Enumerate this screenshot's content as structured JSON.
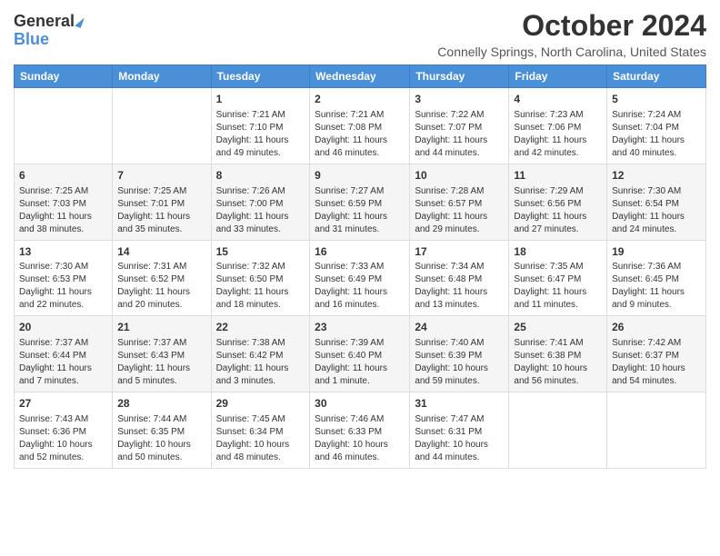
{
  "logo": {
    "general": "General",
    "blue": "Blue"
  },
  "title": "October 2024",
  "subtitle": "Connelly Springs, North Carolina, United States",
  "days_header": [
    "Sunday",
    "Monday",
    "Tuesday",
    "Wednesday",
    "Thursday",
    "Friday",
    "Saturday"
  ],
  "weeks": [
    [
      {
        "day": "",
        "sunrise": "",
        "sunset": "",
        "daylight": ""
      },
      {
        "day": "",
        "sunrise": "",
        "sunset": "",
        "daylight": ""
      },
      {
        "day": "1",
        "sunrise": "Sunrise: 7:21 AM",
        "sunset": "Sunset: 7:10 PM",
        "daylight": "Daylight: 11 hours and 49 minutes."
      },
      {
        "day": "2",
        "sunrise": "Sunrise: 7:21 AM",
        "sunset": "Sunset: 7:08 PM",
        "daylight": "Daylight: 11 hours and 46 minutes."
      },
      {
        "day": "3",
        "sunrise": "Sunrise: 7:22 AM",
        "sunset": "Sunset: 7:07 PM",
        "daylight": "Daylight: 11 hours and 44 minutes."
      },
      {
        "day": "4",
        "sunrise": "Sunrise: 7:23 AM",
        "sunset": "Sunset: 7:06 PM",
        "daylight": "Daylight: 11 hours and 42 minutes."
      },
      {
        "day": "5",
        "sunrise": "Sunrise: 7:24 AM",
        "sunset": "Sunset: 7:04 PM",
        "daylight": "Daylight: 11 hours and 40 minutes."
      }
    ],
    [
      {
        "day": "6",
        "sunrise": "Sunrise: 7:25 AM",
        "sunset": "Sunset: 7:03 PM",
        "daylight": "Daylight: 11 hours and 38 minutes."
      },
      {
        "day": "7",
        "sunrise": "Sunrise: 7:25 AM",
        "sunset": "Sunset: 7:01 PM",
        "daylight": "Daylight: 11 hours and 35 minutes."
      },
      {
        "day": "8",
        "sunrise": "Sunrise: 7:26 AM",
        "sunset": "Sunset: 7:00 PM",
        "daylight": "Daylight: 11 hours and 33 minutes."
      },
      {
        "day": "9",
        "sunrise": "Sunrise: 7:27 AM",
        "sunset": "Sunset: 6:59 PM",
        "daylight": "Daylight: 11 hours and 31 minutes."
      },
      {
        "day": "10",
        "sunrise": "Sunrise: 7:28 AM",
        "sunset": "Sunset: 6:57 PM",
        "daylight": "Daylight: 11 hours and 29 minutes."
      },
      {
        "day": "11",
        "sunrise": "Sunrise: 7:29 AM",
        "sunset": "Sunset: 6:56 PM",
        "daylight": "Daylight: 11 hours and 27 minutes."
      },
      {
        "day": "12",
        "sunrise": "Sunrise: 7:30 AM",
        "sunset": "Sunset: 6:54 PM",
        "daylight": "Daylight: 11 hours and 24 minutes."
      }
    ],
    [
      {
        "day": "13",
        "sunrise": "Sunrise: 7:30 AM",
        "sunset": "Sunset: 6:53 PM",
        "daylight": "Daylight: 11 hours and 22 minutes."
      },
      {
        "day": "14",
        "sunrise": "Sunrise: 7:31 AM",
        "sunset": "Sunset: 6:52 PM",
        "daylight": "Daylight: 11 hours and 20 minutes."
      },
      {
        "day": "15",
        "sunrise": "Sunrise: 7:32 AM",
        "sunset": "Sunset: 6:50 PM",
        "daylight": "Daylight: 11 hours and 18 minutes."
      },
      {
        "day": "16",
        "sunrise": "Sunrise: 7:33 AM",
        "sunset": "Sunset: 6:49 PM",
        "daylight": "Daylight: 11 hours and 16 minutes."
      },
      {
        "day": "17",
        "sunrise": "Sunrise: 7:34 AM",
        "sunset": "Sunset: 6:48 PM",
        "daylight": "Daylight: 11 hours and 13 minutes."
      },
      {
        "day": "18",
        "sunrise": "Sunrise: 7:35 AM",
        "sunset": "Sunset: 6:47 PM",
        "daylight": "Daylight: 11 hours and 11 minutes."
      },
      {
        "day": "19",
        "sunrise": "Sunrise: 7:36 AM",
        "sunset": "Sunset: 6:45 PM",
        "daylight": "Daylight: 11 hours and 9 minutes."
      }
    ],
    [
      {
        "day": "20",
        "sunrise": "Sunrise: 7:37 AM",
        "sunset": "Sunset: 6:44 PM",
        "daylight": "Daylight: 11 hours and 7 minutes."
      },
      {
        "day": "21",
        "sunrise": "Sunrise: 7:37 AM",
        "sunset": "Sunset: 6:43 PM",
        "daylight": "Daylight: 11 hours and 5 minutes."
      },
      {
        "day": "22",
        "sunrise": "Sunrise: 7:38 AM",
        "sunset": "Sunset: 6:42 PM",
        "daylight": "Daylight: 11 hours and 3 minutes."
      },
      {
        "day": "23",
        "sunrise": "Sunrise: 7:39 AM",
        "sunset": "Sunset: 6:40 PM",
        "daylight": "Daylight: 11 hours and 1 minute."
      },
      {
        "day": "24",
        "sunrise": "Sunrise: 7:40 AM",
        "sunset": "Sunset: 6:39 PM",
        "daylight": "Daylight: 10 hours and 59 minutes."
      },
      {
        "day": "25",
        "sunrise": "Sunrise: 7:41 AM",
        "sunset": "Sunset: 6:38 PM",
        "daylight": "Daylight: 10 hours and 56 minutes."
      },
      {
        "day": "26",
        "sunrise": "Sunrise: 7:42 AM",
        "sunset": "Sunset: 6:37 PM",
        "daylight": "Daylight: 10 hours and 54 minutes."
      }
    ],
    [
      {
        "day": "27",
        "sunrise": "Sunrise: 7:43 AM",
        "sunset": "Sunset: 6:36 PM",
        "daylight": "Daylight: 10 hours and 52 minutes."
      },
      {
        "day": "28",
        "sunrise": "Sunrise: 7:44 AM",
        "sunset": "Sunset: 6:35 PM",
        "daylight": "Daylight: 10 hours and 50 minutes."
      },
      {
        "day": "29",
        "sunrise": "Sunrise: 7:45 AM",
        "sunset": "Sunset: 6:34 PM",
        "daylight": "Daylight: 10 hours and 48 minutes."
      },
      {
        "day": "30",
        "sunrise": "Sunrise: 7:46 AM",
        "sunset": "Sunset: 6:33 PM",
        "daylight": "Daylight: 10 hours and 46 minutes."
      },
      {
        "day": "31",
        "sunrise": "Sunrise: 7:47 AM",
        "sunset": "Sunset: 6:31 PM",
        "daylight": "Daylight: 10 hours and 44 minutes."
      },
      {
        "day": "",
        "sunrise": "",
        "sunset": "",
        "daylight": ""
      },
      {
        "day": "",
        "sunrise": "",
        "sunset": "",
        "daylight": ""
      }
    ]
  ]
}
